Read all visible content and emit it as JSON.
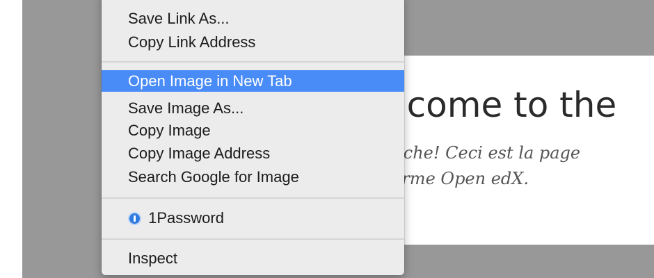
{
  "webpage": {
    "heading": "elcome to the",
    "intro_line_1": "arche! Ceci est la page",
    "intro_line_2": "forme Open edX."
  },
  "context_menu": {
    "items": [
      {
        "label": "Save Link As..."
      },
      {
        "label": "Copy Link Address"
      },
      {
        "label": "Open Image in New Tab",
        "highlighted": true
      },
      {
        "label": "Save Image As..."
      },
      {
        "label": "Copy Image"
      },
      {
        "label": "Copy Image Address"
      },
      {
        "label": "Search Google for Image"
      },
      {
        "label": "1Password",
        "icon": "onepassword-icon"
      },
      {
        "label": "Inspect"
      }
    ]
  },
  "colors": {
    "overlay": "#989898",
    "menu_background": "#ececec",
    "highlight": "#4a8cf7"
  }
}
